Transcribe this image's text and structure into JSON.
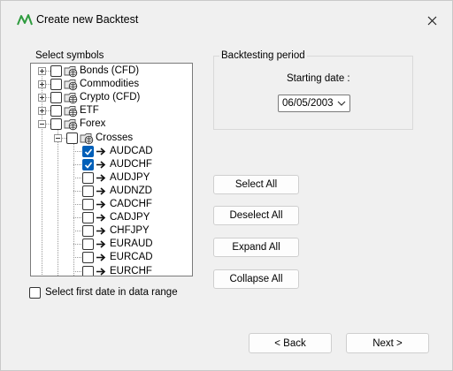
{
  "window": {
    "title": "Create new Backtest",
    "close_glyph": "✕"
  },
  "symbols": {
    "group_label": "Select symbols",
    "tree": [
      {
        "label": "Bonds (CFD)",
        "level": 0,
        "expander": "plus",
        "checked": false,
        "icon": "folder-globe-icon"
      },
      {
        "label": "Commodities",
        "level": 0,
        "expander": "plus",
        "checked": false,
        "icon": "folder-globe-icon"
      },
      {
        "label": "Crypto (CFD)",
        "level": 0,
        "expander": "plus",
        "checked": false,
        "icon": "folder-globe-icon"
      },
      {
        "label": "ETF",
        "level": 0,
        "expander": "plus",
        "checked": false,
        "icon": "folder-globe-icon"
      },
      {
        "label": "Forex",
        "level": 0,
        "expander": "minus",
        "checked": false,
        "icon": "folder-globe-icon"
      },
      {
        "label": "Crosses",
        "level": 1,
        "expander": "minus",
        "checked": false,
        "icon": "folder-globe-icon"
      },
      {
        "label": "AUDCAD",
        "level": 2,
        "checked": true,
        "icon": "arrow-right-icon"
      },
      {
        "label": "AUDCHF",
        "level": 2,
        "checked": true,
        "icon": "arrow-right-icon"
      },
      {
        "label": "AUDJPY",
        "level": 2,
        "checked": false,
        "icon": "arrow-right-icon"
      },
      {
        "label": "AUDNZD",
        "level": 2,
        "checked": false,
        "icon": "arrow-right-icon"
      },
      {
        "label": "CADCHF",
        "level": 2,
        "checked": false,
        "icon": "arrow-right-icon"
      },
      {
        "label": "CADJPY",
        "level": 2,
        "checked": false,
        "icon": "arrow-right-icon"
      },
      {
        "label": "CHFJPY",
        "level": 2,
        "checked": false,
        "icon": "arrow-right-icon"
      },
      {
        "label": "EURAUD",
        "level": 2,
        "checked": false,
        "icon": "arrow-right-icon"
      },
      {
        "label": "EURCAD",
        "level": 2,
        "checked": false,
        "icon": "arrow-right-icon"
      },
      {
        "label": "EURCHF",
        "level": 2,
        "checked": false,
        "icon": "arrow-right-icon"
      }
    ],
    "first_date_option": {
      "label": "Select first date in data range",
      "checked": false
    }
  },
  "period": {
    "group_label": "Backtesting period",
    "starting_date_label": "Starting date :",
    "starting_date_value": "06/05/2003"
  },
  "actions": {
    "select_all": "Select All",
    "deselect_all": "Deselect All",
    "expand_all": "Expand All",
    "collapse_all": "Collapse All"
  },
  "footer": {
    "back": "< Back",
    "next": "Next >"
  },
  "colors": {
    "accent": "#005fb8",
    "logo_green": "#2e9b3e",
    "window_bg": "#f0f0f0"
  }
}
